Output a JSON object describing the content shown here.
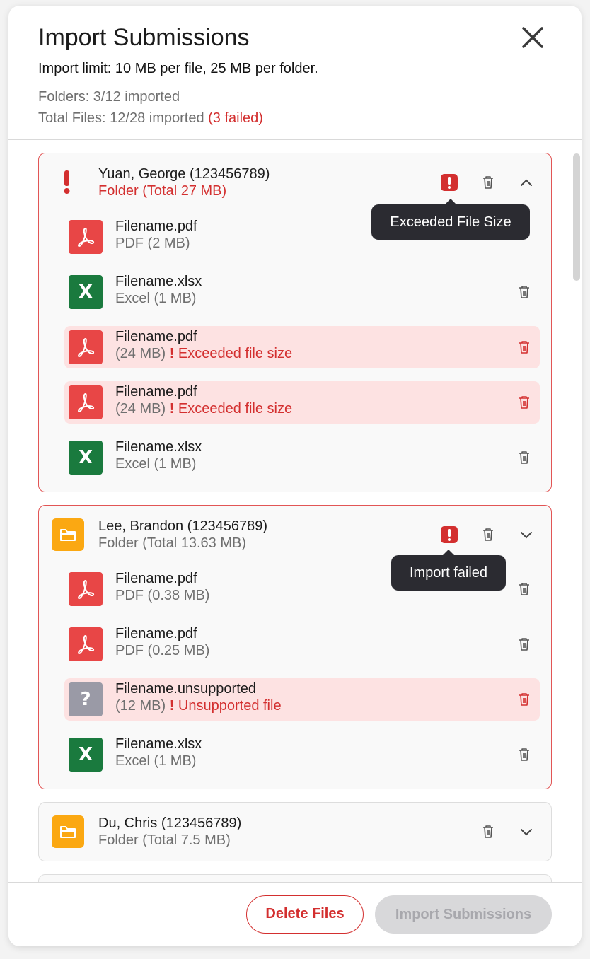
{
  "modal": {
    "title": "Import Submissions",
    "limit_text": "Import limit: 10 MB per file, 25 MB per folder.",
    "folders_stat": "Folders: 3/12 imported",
    "files_stat_prefix": "Total Files: 12/28 imported",
    "files_failed": "(3 failed)"
  },
  "folders": [
    {
      "name": "Yuan, George (123456789)",
      "size": "Folder (Total 27 MB)",
      "error_tooltip": "Exceeded File Size",
      "expanded": true,
      "files": [
        {
          "name": "Filename.pdf",
          "meta": "PDF (2 MB)",
          "icon": "pdf-icon"
        },
        {
          "name": "Filename.xlsx",
          "meta": "Excel (1 MB)",
          "icon": "excel-icon"
        },
        {
          "name": "Filename.pdf",
          "meta": "(24 MB)",
          "error": "Exceeded file size",
          "icon": "pdf-icon"
        },
        {
          "name": "Filename.pdf",
          "meta": "(24 MB)",
          "error": "Exceeded file size",
          "icon": "pdf-icon"
        },
        {
          "name": "Filename.xlsx",
          "meta": "Excel (1 MB)",
          "icon": "excel-icon"
        }
      ]
    },
    {
      "name": "Lee, Brandon (123456789)",
      "size": "Folder (Total 13.63 MB)",
      "error_tooltip": "Import failed",
      "expanded": false,
      "files": [
        {
          "name": "Filename.pdf",
          "meta": "PDF (0.38 MB)",
          "icon": "pdf-icon"
        },
        {
          "name": "Filename.pdf",
          "meta": "PDF (0.25 MB)",
          "icon": "pdf-icon"
        },
        {
          "name": "Filename.unsupported",
          "meta": "(12 MB)",
          "error": "Unsupported file",
          "icon": "question-icon"
        },
        {
          "name": "Filename.xlsx",
          "meta": "Excel (1 MB)",
          "icon": "excel-icon"
        }
      ]
    },
    {
      "name": "Du, Chris (123456789)",
      "size": "Folder (Total 7.5 MB)"
    }
  ],
  "footer": {
    "delete_label": "Delete Files",
    "import_label": "Import Submissions"
  },
  "colors": {
    "error": "#d32f2f",
    "folder": "#fba812",
    "pdf": "#e84646",
    "excel": "#1a7a3e",
    "error_row_bg": "#fde2e2"
  }
}
